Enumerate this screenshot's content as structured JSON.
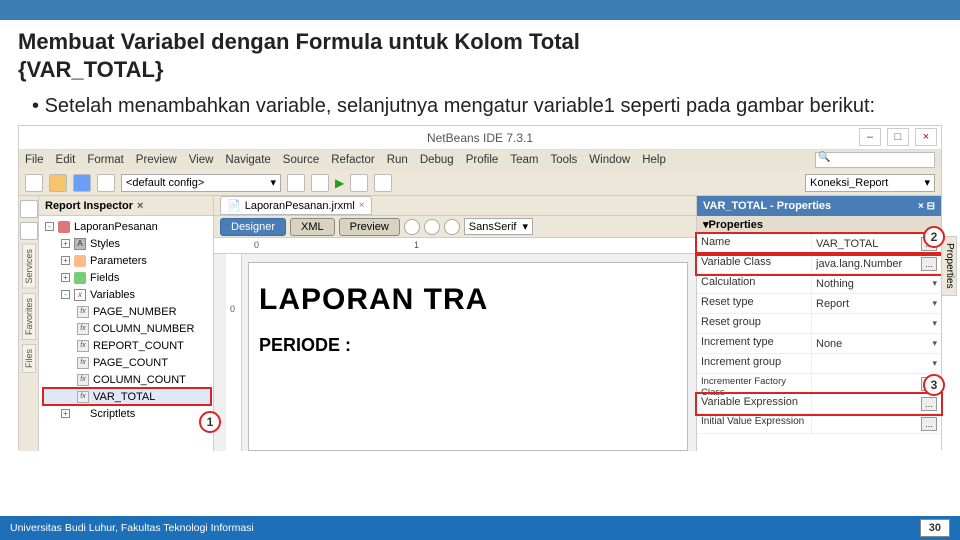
{
  "slide": {
    "title_line1": "Membuat Variabel dengan Formula untuk Kolom Total",
    "title_line2": "{VAR_TOTAL}",
    "bullet": "Setelah menambahkan variable, selanjutnya mengatur variable1 seperti pada gambar berikut:",
    "footer": "Universitas Budi Luhur, Fakultas Teknologi Informasi",
    "page": "30"
  },
  "ide": {
    "title": "NetBeans IDE 7.3.1",
    "menus": [
      "File",
      "Edit",
      "Format",
      "Preview",
      "View",
      "Navigate",
      "Source",
      "Refactor",
      "Run",
      "Debug",
      "Profile",
      "Team",
      "Tools",
      "Window",
      "Help"
    ],
    "config": "<default config>",
    "connection": "Koneksi_Report",
    "left_tabs": [
      "Services",
      "Favorites",
      "Files"
    ],
    "inspector_tab": "Report Inspector",
    "doc_tab": "LaporanPesanan.jrxml",
    "mode_tabs": [
      "Designer",
      "XML",
      "Preview"
    ],
    "font": "SansSerif",
    "ruler_marks": {
      "r0": "0",
      "r1": "1",
      "v0": "0"
    },
    "report_title": "LAPORAN TRA",
    "report_subtitle": "PERIODE :",
    "tree": {
      "root": "LaporanPesanan",
      "styles": "Styles",
      "parameters": "Parameters",
      "fields": "Fields",
      "variables": "Variables",
      "v_pagenum": "PAGE_NUMBER",
      "v_colnum": "COLUMN_NUMBER",
      "v_repcount": "REPORT_COUNT",
      "v_pagecount": "PAGE_COUNT",
      "v_colcount": "COLUMN_COUNT",
      "v_vartotal": "VAR_TOTAL",
      "scriptlets": "Scriptlets"
    },
    "props_title": "VAR_TOTAL - Properties",
    "props_section": "Properties",
    "right_tab": "Properties",
    "props": {
      "name_k": "Name",
      "name_v": "VAR_TOTAL",
      "vclass_k": "Variable Class",
      "vclass_v": "java.lang.Number",
      "calc_k": "Calculation",
      "calc_v": "Nothing",
      "rtype_k": "Reset type",
      "rtype_v": "Report",
      "rgroup_k": "Reset group",
      "rgroup_v": "",
      "itype_k": "Increment type",
      "itype_v": "None",
      "igroup_k": "Increment group",
      "igroup_v": "",
      "ifactory_k": "Incrementer Factory Class",
      "ifactory_v": "",
      "vexpr_k": "Variable Expression",
      "vexpr_v": "",
      "iexpr_k": "Initial Value Expression",
      "iexpr_v": ""
    },
    "callouts": {
      "c1": "1",
      "c2": "2",
      "c3": "3"
    }
  }
}
